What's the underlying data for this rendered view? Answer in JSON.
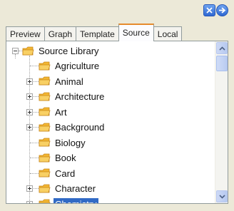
{
  "tabs": [
    {
      "label": "Preview",
      "active": false
    },
    {
      "label": "Graph",
      "active": false
    },
    {
      "label": "Template",
      "active": false
    },
    {
      "label": "Source",
      "active": true
    },
    {
      "label": "Local",
      "active": false
    }
  ],
  "tree": {
    "root": {
      "label": "Source Library",
      "expanded": true
    },
    "items": [
      {
        "label": "Agriculture",
        "has_children": false,
        "selected": false
      },
      {
        "label": "Animal",
        "has_children": true,
        "selected": false
      },
      {
        "label": "Architecture",
        "has_children": true,
        "selected": false
      },
      {
        "label": "Art",
        "has_children": true,
        "selected": false
      },
      {
        "label": "Background",
        "has_children": true,
        "selected": false
      },
      {
        "label": "Biology",
        "has_children": false,
        "selected": false
      },
      {
        "label": "Book",
        "has_children": false,
        "selected": false
      },
      {
        "label": "Card",
        "has_children": false,
        "selected": false
      },
      {
        "label": "Character",
        "has_children": true,
        "selected": false
      },
      {
        "label": "Chemistry",
        "has_children": true,
        "selected": true
      }
    ]
  },
  "colors": {
    "selection": "#316ac5",
    "active_tab_accent": "#e68b2c",
    "folder": "#f2b632"
  },
  "icons": {
    "close": "close-icon",
    "next": "arrow-right-icon",
    "folder": "folder-icon",
    "expand": "plus-expander-icon",
    "collapse": "minus-expander-icon",
    "scroll_up": "chevron-up-icon",
    "scroll_down": "chevron-down-icon"
  }
}
